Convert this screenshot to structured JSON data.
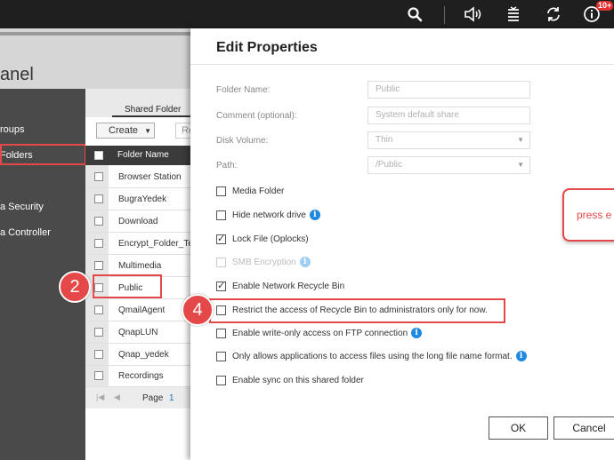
{
  "topbar": {
    "icons": [
      "search-icon",
      "volume-icon",
      "tasks-icon",
      "sync-icon",
      "info-icon"
    ],
    "badge": "10+"
  },
  "panel": {
    "title": "anel",
    "nav": [
      "roups",
      "Folders",
      "a Security",
      "a Controller"
    ]
  },
  "shared_folders": {
    "tab": "Shared Folder",
    "create_label": "Create",
    "second_button": "Re",
    "column_header": "Folder Name",
    "rows": [
      "Browser Station",
      "BugraYedek",
      "Download",
      "Encrypt_Folder_Tes",
      "Multimedia",
      "Public",
      "QmailAgent",
      "QnapLUN",
      "Qnap_yedek",
      "Recordings"
    ],
    "pager_label": "Page",
    "pager_value": "1"
  },
  "dialog": {
    "title": "Edit Properties",
    "fields": [
      {
        "label": "Folder Name:",
        "value": "Public"
      },
      {
        "label": "Comment (optional):",
        "value": "System default share"
      },
      {
        "label": "Disk Volume:",
        "value": "Thin"
      },
      {
        "label": "Path:",
        "value": "/Public"
      }
    ],
    "options": [
      {
        "label": "Media Folder",
        "checked": false,
        "disabled": false,
        "info": false
      },
      {
        "label": "Hide network drive",
        "checked": false,
        "disabled": false,
        "info": true
      },
      {
        "label": "Lock File (Oplocks)",
        "checked": true,
        "disabled": false,
        "info": false
      },
      {
        "label": "SMB Encryption",
        "checked": false,
        "disabled": true,
        "info": true
      },
      {
        "label": "Enable Network Recycle Bin",
        "checked": true,
        "disabled": false,
        "info": false
      },
      {
        "label": "Restrict the access of Recycle Bin to administrators only for now.",
        "checked": false,
        "disabled": false,
        "info": false
      },
      {
        "label": "Enable write-only access on FTP connection",
        "checked": false,
        "disabled": false,
        "info": true
      },
      {
        "label": "Only allows applications to access files using the long file name format.",
        "checked": false,
        "disabled": false,
        "info": true
      },
      {
        "label": "Enable sync on this shared folder",
        "checked": false,
        "disabled": false,
        "info": false
      }
    ],
    "info_glyph": "i",
    "ok_label": "OK",
    "cancel_label": "Cancel"
  },
  "annotations": {
    "step_public": "2",
    "step_restrict": "4",
    "press_text": "press e"
  },
  "colors": {
    "accent_red": "#e54848",
    "info_blue": "#1d8ae0"
  }
}
